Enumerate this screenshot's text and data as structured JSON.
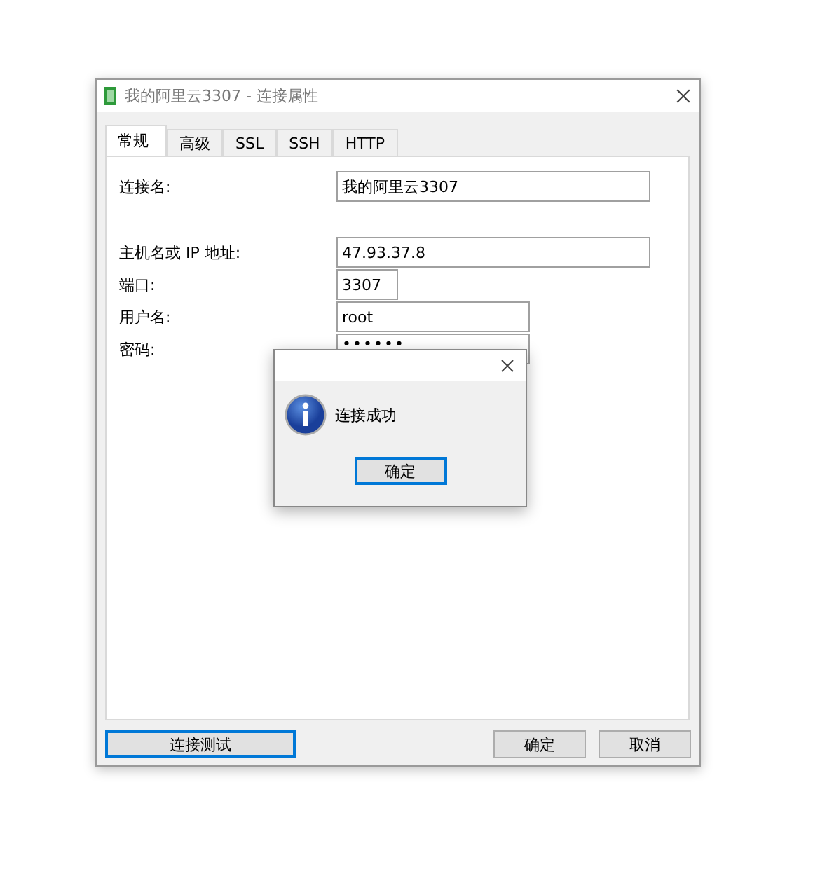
{
  "window": {
    "title": "我的阿里云3307 - 连接属性"
  },
  "tabs": [
    {
      "label": "常规",
      "selected": true
    },
    {
      "label": "高级",
      "selected": false
    },
    {
      "label": "SSL",
      "selected": false
    },
    {
      "label": "SSH",
      "selected": false
    },
    {
      "label": "HTTP",
      "selected": false
    }
  ],
  "fields": [
    {
      "label": "连接名:",
      "value": "我的阿里云3307"
    },
    {
      "label": "主机名或 IP 地址:",
      "value": "47.93.37.8"
    },
    {
      "label": "端口:",
      "value": "3307"
    },
    {
      "label": "用户名:",
      "value": "root"
    },
    {
      "label": "密码:",
      "value": "••••••",
      "kind": "password"
    }
  ],
  "buttons": {
    "test": "连接测试",
    "ok": "确定",
    "cancel": "取消"
  },
  "dialog": {
    "message": "连接成功",
    "button": "确定"
  }
}
